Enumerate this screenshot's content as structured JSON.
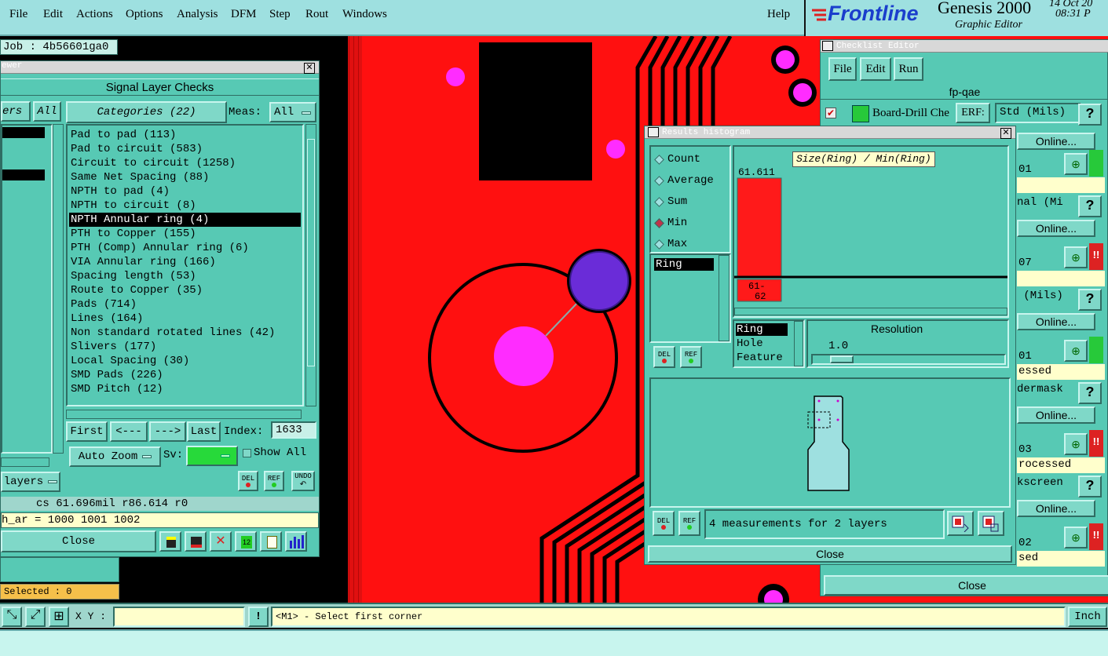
{
  "menubar": {
    "items": [
      "File",
      "Edit",
      "Actions",
      "Options",
      "Analysis",
      "DFM",
      "Step",
      "Rout",
      "Windows"
    ],
    "help": "Help"
  },
  "logo": {
    "brand": "Frontline",
    "product": "Genesis 2000",
    "subtitle": "Graphic Editor",
    "date": "14 Oct 20",
    "time": "08:31 P"
  },
  "job": {
    "label": "Job : 4b56601ga0"
  },
  "viewer": {
    "title": "ewer",
    "header": "Signal Layer Checks",
    "layers_tab": "ers",
    "all_btn": "All",
    "categories_btn": "Categories (22)",
    "meas_label": "Meas:",
    "meas_value": "All",
    "categories": [
      "Pad to pad (113)",
      "Pad to circuit (583)",
      "Circuit to circuit (1258)",
      "Same Net Spacing (88)",
      "NPTH to pad (4)",
      "NPTH to circuit (8)",
      "NPTH Annular ring (4)",
      "PTH to Copper (155)",
      "PTH (Comp) Annular ring (6)",
      "VIA Annular ring (166)",
      "Spacing length (53)",
      "Route to Copper (35)",
      "Pads (714)",
      "Lines (164)",
      "Non standard rotated lines (42)",
      "Slivers (177)",
      "Local Spacing (30)",
      "SMD Pads (226)",
      "SMD Pitch (12)"
    ],
    "selected_index": 6,
    "nav": {
      "first": "First",
      "prev": "<---",
      "next": "--->",
      "last": "Last",
      "index_label": "Index:",
      "index_value": "1633"
    },
    "auto_zoom": "Auto Zoom",
    "sv_label": "Sv:",
    "show_all": "Show All",
    "layers_btn": "layers",
    "del": "DEL",
    "ref": "REF",
    "undo": "UNDO",
    "status_line": "cs 61.696mil  r86.614  r0",
    "attr_line": "h_ar = 1000 1001 1002",
    "close": "Close"
  },
  "selected_label": "Selected : 0",
  "histogram": {
    "title": "Results histogram",
    "modes": [
      "Count",
      "Average",
      "Sum",
      "Min",
      "Max"
    ],
    "selected_mode": "Min",
    "chart_title": "Size(Ring) / Min(Ring)",
    "bar_value_label": "61.611",
    "bar_bin_label": "61-62",
    "attr_list_selected": "Ring",
    "axis_options": [
      "Ring",
      "Hole",
      "Feature"
    ],
    "resolution_label": "Resolution",
    "resolution_value": "1.0",
    "measurement_text": "4 measurements for 2 layers",
    "del": "DEL",
    "ref": "REF",
    "close": "Close"
  },
  "chart_data": {
    "type": "bar",
    "categories": [
      "61-62"
    ],
    "values": [
      61.611
    ],
    "title": "Size(Ring) / Min(Ring)"
  },
  "checklist": {
    "title": "Checklist Editor",
    "menus": [
      "File",
      "Edit",
      "Run"
    ],
    "name": "fp-qae",
    "row1_label": "Board-Drill Che",
    "erf_label": "ERF:",
    "erf_value": "Std (Mils)",
    "rows": [
      {
        "code": "01",
        "status": "",
        "online": "Online...",
        "mid": "nal (Mi"
      },
      {
        "code": "07",
        "status": "",
        "online": "Online...",
        "mid": " (Mils)"
      },
      {
        "code": "01",
        "status": "essed",
        "online": "Online...",
        "mid": "dermask"
      },
      {
        "code": "03",
        "status": "rocessed",
        "online": "Online...",
        "mid": "kscreen"
      },
      {
        "code": "02",
        "status": "sed",
        "online": "",
        "mid": ""
      }
    ],
    "first_online": "Online...",
    "help": "?",
    "close": "Close"
  },
  "bottom": {
    "xy_label": "X Y :",
    "xy_value": "",
    "prompt": "<M1> - Select first corner",
    "units": "Inch",
    "excl": "!"
  }
}
